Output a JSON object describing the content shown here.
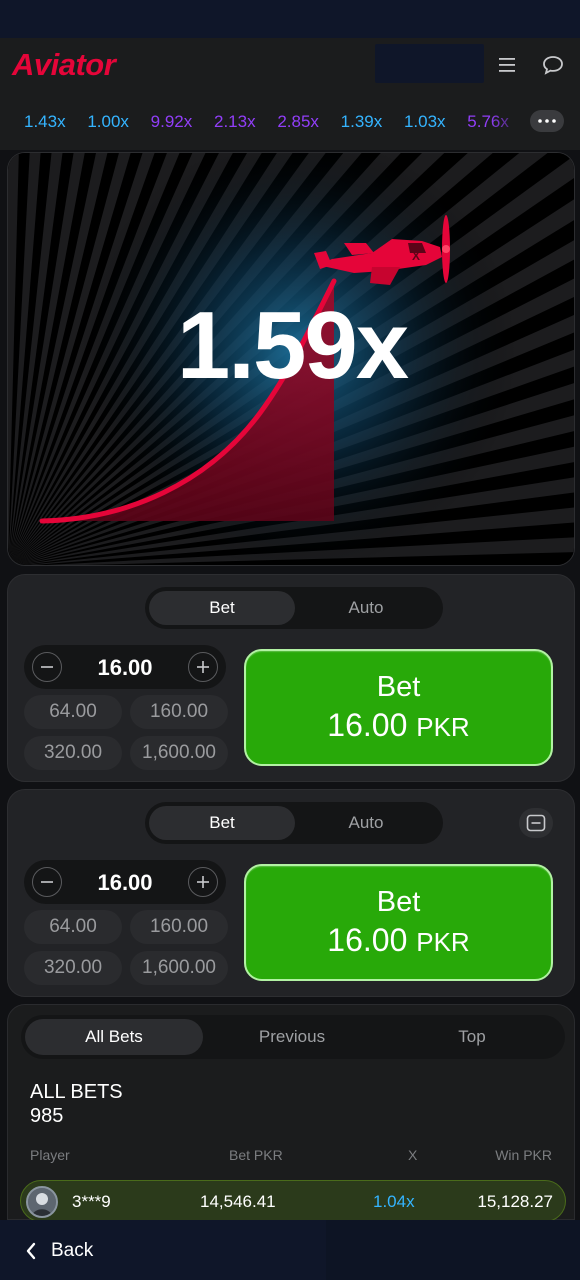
{
  "app": {
    "title": "Aviator"
  },
  "header": {
    "menu_icon": "menu-icon",
    "chat_icon": "chat-icon"
  },
  "history": {
    "values": [
      "1.43x",
      "1.00x",
      "9.92x",
      "2.13x",
      "2.85x",
      "1.39x",
      "1.03x",
      "5.76x"
    ],
    "colors": [
      "#34b4ff",
      "#34b4ff",
      "#913ef8",
      "#913ef8",
      "#913ef8",
      "#34b4ff",
      "#34b4ff",
      "#913ef8"
    ],
    "more_icon": "more-dots-icon"
  },
  "game": {
    "multiplier": "1.59x",
    "curve_color": "#e50539",
    "plane_icon": "airplane-icon"
  },
  "panels": [
    {
      "tabs": [
        "Bet",
        "Auto"
      ],
      "amount": "16.00",
      "quick": [
        "64.00",
        "160.00",
        "320.00",
        "1,600.00"
      ],
      "bet_label": "Bet",
      "bet_amount": "16.00",
      "currency": "PKR"
    },
    {
      "tabs": [
        "Bet",
        "Auto"
      ],
      "amount": "16.00",
      "quick": [
        "64.00",
        "160.00",
        "320.00",
        "1,600.00"
      ],
      "bet_label": "Bet",
      "bet_amount": "16.00",
      "currency": "PKR",
      "remove_icon": "minus-box-icon"
    }
  ],
  "bets": {
    "tabs": [
      "All Bets",
      "Previous",
      "Top"
    ],
    "title": "ALL BETS",
    "count": "985",
    "columns": [
      "Player",
      "Bet PKR",
      "X",
      "Win PKR"
    ],
    "rows": [
      {
        "player": "3***9",
        "bet": "14,546.41",
        "x": "1.04x",
        "win": "15,128.27"
      }
    ]
  },
  "nav": {
    "back_label": "Back"
  }
}
